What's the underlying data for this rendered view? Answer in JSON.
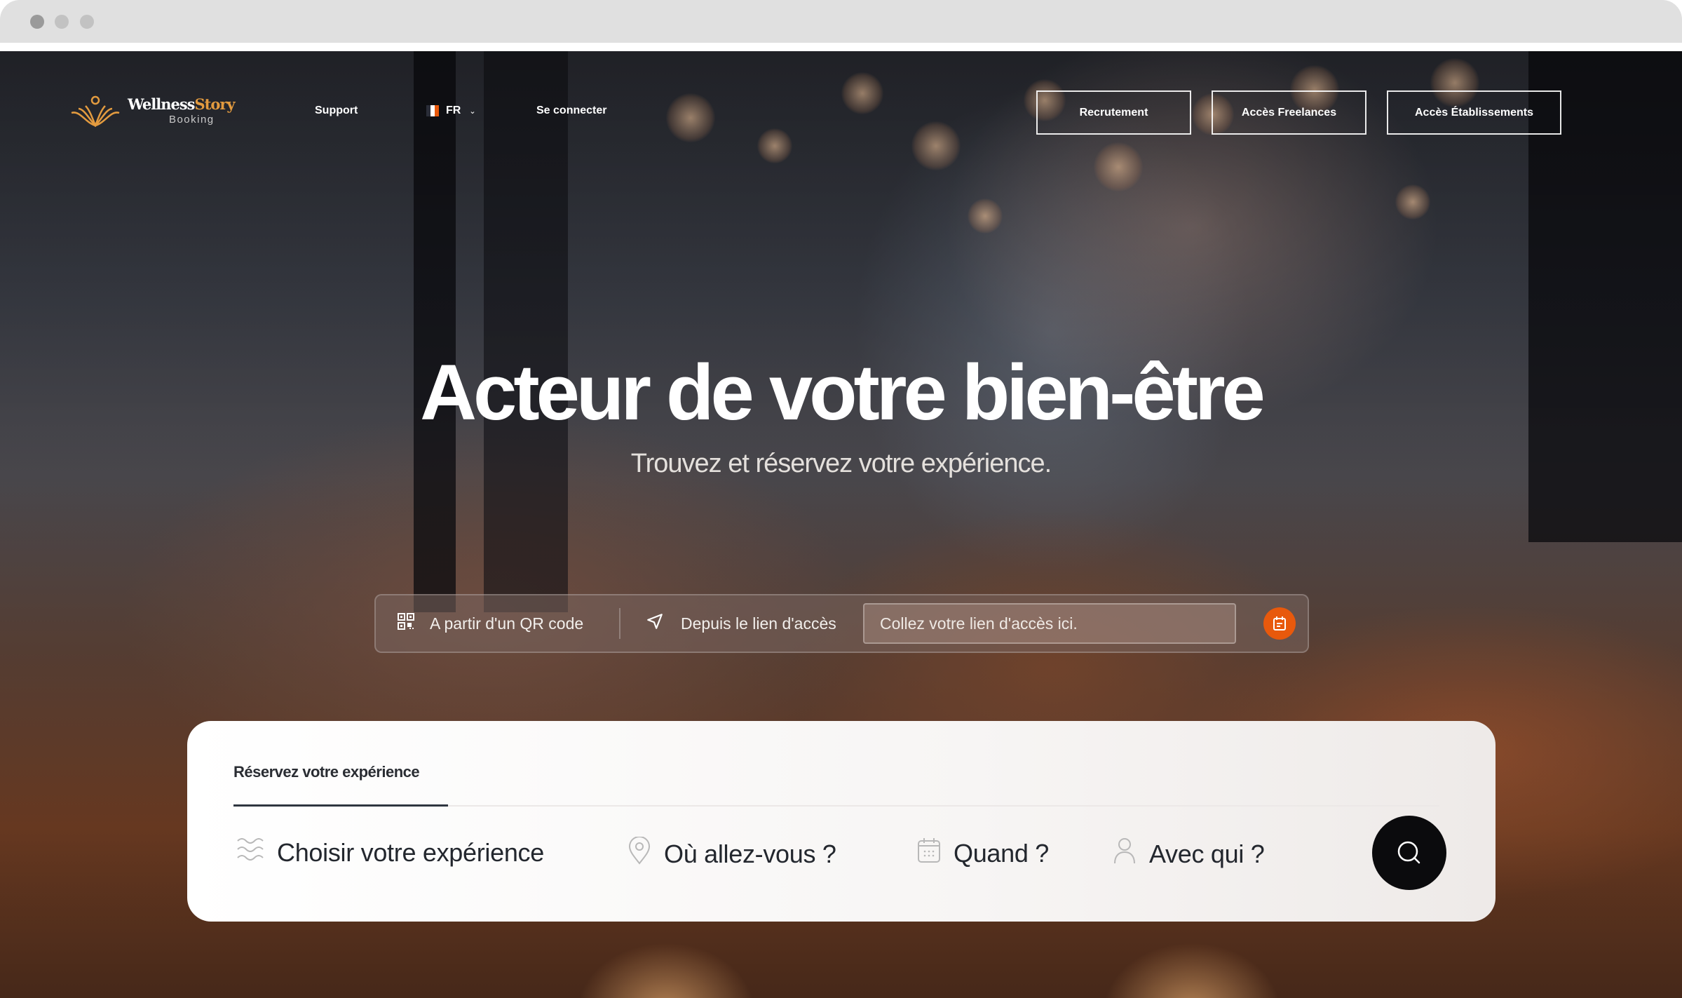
{
  "window": {
    "controls": [
      "close",
      "minimize",
      "maximize"
    ]
  },
  "nav": {
    "logo": {
      "name_main": "Wellness",
      "name_accent": "Story",
      "subtitle": "Booking",
      "icon": "lotus-icon"
    },
    "links": {
      "support": "Support",
      "language": "FR",
      "login": "Se connecter"
    },
    "buttons": {
      "recruitment": "Recrutement",
      "freelances": "Accès Freelances",
      "establishments": "Accès Établissements"
    }
  },
  "hero": {
    "title": "Acteur de votre bien-être",
    "subtitle": "Trouvez et réservez votre expérience."
  },
  "access": {
    "qr_label": "A partir d'un QR code",
    "link_label": "Depuis le lien d'accès",
    "input_placeholder": "Collez votre lien d'accès ici.",
    "input_value": "",
    "accent_color": "#e8590c"
  },
  "booking": {
    "tab_label": "Réservez votre expérience",
    "fields": {
      "experience": "Choisir votre expérience",
      "where": "Où allez-vous ?",
      "when": "Quand ?",
      "who": "Avec qui ?"
    },
    "search_icon": "search-icon"
  },
  "colors": {
    "brand_gold": "#e39b3f",
    "accent_orange": "#e8590c",
    "text_dark": "#23272e",
    "search_button": "#0b0b0d"
  }
}
